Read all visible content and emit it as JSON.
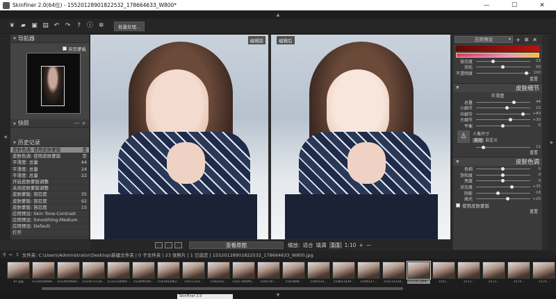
{
  "window": {
    "title": "SkinFiner 2.0(64位) - 15520128901822532_178664633_W800*",
    "minimize": "—",
    "maximize": "☐",
    "close": "✕"
  },
  "toolbar": {
    "batch_label": "批量处理..."
  },
  "left_panel": {
    "navigator_title": "导航器",
    "compare_label": "另页蒙板",
    "snapshot_title": "快照",
    "snapshot_ctrls": "— +",
    "history_title": "历史记录",
    "history": [
      {
        "label": "皮肤色调: 使用皮肤蒙版",
        "value": "是"
      },
      {
        "label": "皮肤色调: 使用皮肤蒙版",
        "value": "否"
      },
      {
        "label": "平滑度: 总量",
        "value": "44"
      },
      {
        "label": "平滑度: 总量",
        "value": "24"
      },
      {
        "label": "平滑度: 总量",
        "value": "22"
      },
      {
        "label": "开启皮肤蒙版调整",
        "value": ""
      },
      {
        "label": "关闭皮肤蒙版调整",
        "value": ""
      },
      {
        "label": "皮肤蒙版: 容忍度",
        "value": "35"
      },
      {
        "label": "皮肤蒙版: 容忍度",
        "value": "92"
      },
      {
        "label": "皮肤蒙版: 容忍度",
        "value": "15"
      },
      {
        "label": "应用预设: Skin Tone-Contrast",
        "value": ""
      },
      {
        "label": "应用预设: Smoothing-Medium",
        "value": ""
      },
      {
        "label": "应用预设: Default",
        "value": ""
      },
      {
        "label": "打开",
        "value": ""
      }
    ]
  },
  "photos": {
    "left_label": "编辑前",
    "right_label": "编辑后"
  },
  "right_panel": {
    "preset": "应用预设",
    "mask_sliders": [
      {
        "label": "容忍度",
        "value": "15",
        "pos": 0.3
      },
      {
        "label": "羽化",
        "value": "50",
        "pos": 0.5
      },
      {
        "label": "不透明度",
        "value": "100",
        "pos": 0.98
      }
    ],
    "reset": "重置",
    "skin_detail_title": "皮肤细节",
    "smoothness_label": "平滑度",
    "detail_sliders": [
      {
        "label": "总量",
        "value": "44",
        "pos": 0.72
      },
      {
        "label": "小细节",
        "value": "15",
        "pos": 0.58
      },
      {
        "label": "中细节",
        "value": "+80",
        "pos": 0.9
      },
      {
        "label": "大细节",
        "value": "+30",
        "pos": 0.65
      },
      {
        "label": "平衡",
        "value": "0",
        "pos": 0.5
      }
    ],
    "person_size_label": "人像尺寸",
    "person_auto": "自动",
    "person_custom": "自定义",
    "person_value": "11",
    "skin_tone_title": "皮肤色调",
    "tone_sliders": [
      {
        "label": "色相",
        "value": "0",
        "pos": 0.5
      },
      {
        "label": "饱和度",
        "value": "0",
        "pos": 0.5
      },
      {
        "label": "亮度",
        "value": "0",
        "pos": 0.5
      },
      {
        "label": "对比度",
        "value": "+35",
        "pos": 0.68
      },
      {
        "label": "阴影",
        "value": "-18",
        "pos": 0.4
      },
      {
        "label": "高光",
        "value": "+20",
        "pos": 0.6
      }
    ],
    "use_mask_label": "使用皮肤蒙版"
  },
  "viewbar": {
    "view_original": "查看原图",
    "zoom_label": "缩放:",
    "fit": "适合",
    "fill": "填满",
    "one_to_one": "1:1",
    "ratio": "1:10"
  },
  "pathbar": {
    "text": "文件夹: C:\\Users\\Administrator\\Desktop\\新建文件夹 | 0 子文件夹 | 23 张照片 | 1 已选定 | 15520128901822532_178664633_W800.jpg"
  },
  "filmstrip": {
    "items": [
      "d7.jpg",
      "1533058484...",
      "1533059640...",
      "1533071116...",
      "1533118460...",
      "153499184...",
      "1543003062...",
      "15471321...",
      "1542031...",
      "1542746995...",
      "1542787...",
      "1542808...",
      "1544335...",
      "154813339...",
      "1549127...",
      "155112220...",
      "1552012890...",
      "1551...",
      "1572...",
      "1573...",
      "1574...",
      "1574..."
    ],
    "selected_index": 16
  },
  "taskbar": {
    "tab": "SkinFiner 2.0"
  }
}
